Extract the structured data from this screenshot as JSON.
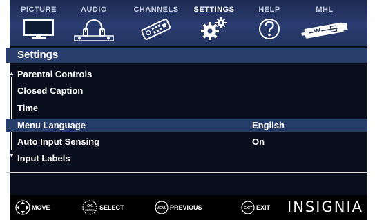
{
  "tabs": [
    {
      "label": "PICTURE",
      "icon": "tv-icon"
    },
    {
      "label": "AUDIO",
      "icon": "headphones-icon"
    },
    {
      "label": "CHANNELS",
      "icon": "remote-icon"
    },
    {
      "label": "SETTINGS",
      "icon": "gears-icon",
      "active": true
    },
    {
      "label": "HELP",
      "icon": "help-icon"
    },
    {
      "label": "MHL",
      "icon": "mhl-cable-icon"
    }
  ],
  "menu": {
    "title": "Settings",
    "items": [
      {
        "label": "Parental Controls",
        "value": ""
      },
      {
        "label": "Closed Caption",
        "value": ""
      },
      {
        "label": "Time",
        "value": ""
      },
      {
        "label": "Menu Language",
        "value": "English",
        "selected": true
      },
      {
        "label": "Auto Input Sensing",
        "value": "On"
      },
      {
        "label": "Input Labels",
        "value": ""
      }
    ]
  },
  "footer": {
    "move": "MOVE",
    "select": "SELECT",
    "select_icon_text": "OK ENTER",
    "previous": "PREVIOUS",
    "previous_icon_text": "MENU",
    "exit": "EXIT",
    "exit_icon_text": "EXIT",
    "brand": "INSIGNIA"
  },
  "colors": {
    "background": "#0a0f1d",
    "tab_bar": "#2b3d70",
    "title_bar": "#2a3e6e",
    "selected_row": "#263d6a",
    "text": "#ffffff"
  }
}
